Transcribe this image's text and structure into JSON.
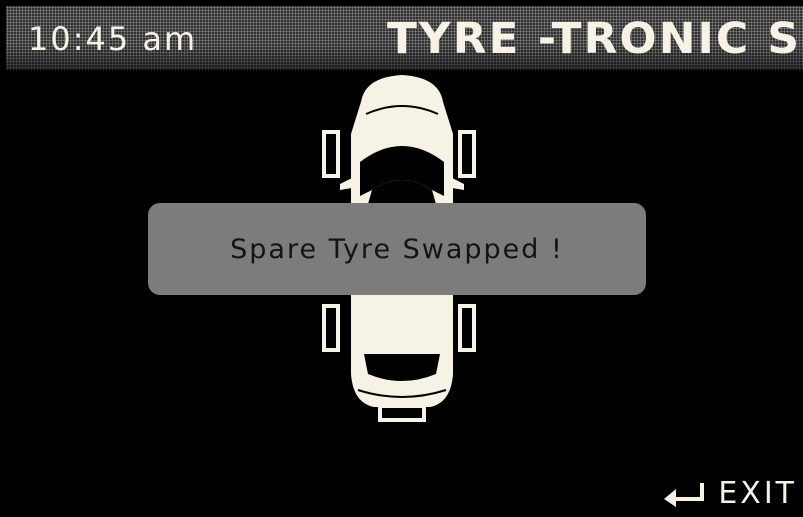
{
  "header": {
    "time": "10:45 am",
    "brand": "TYRE -TRONIC S"
  },
  "popup": {
    "message": "Spare Tyre Swapped !"
  },
  "footer": {
    "exit_label": "EXIT",
    "exit_icon": "enter-return-icon"
  },
  "colors": {
    "background": "#000000",
    "header": "#4a4a4a",
    "text": "#f6f2e6",
    "popup": "#7c7c7c",
    "popup_text": "#141414"
  }
}
